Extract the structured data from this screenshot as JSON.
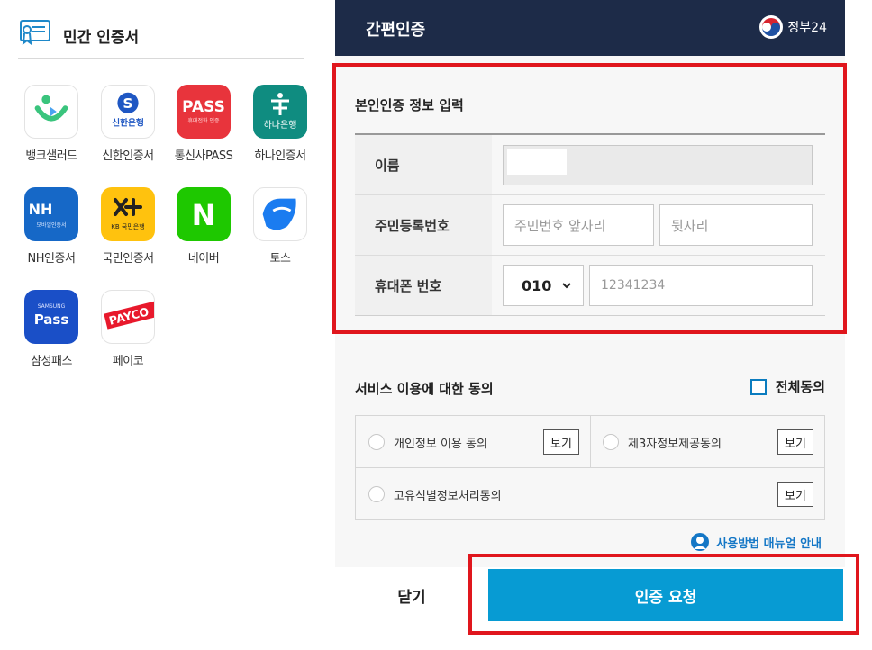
{
  "left": {
    "title": "민간 인증서",
    "apps": [
      {
        "label": "뱅크샐러드",
        "icon": "banksalad-icon"
      },
      {
        "label": "신한인증서",
        "icon": "shinhan-icon",
        "tile_text": "신한은행"
      },
      {
        "label": "통신사PASS",
        "icon": "pass-icon",
        "tile_text": "PASS",
        "tile_sub": "휴대전화 인증"
      },
      {
        "label": "하나인증서",
        "icon": "hana-icon",
        "tile_text": "하나은행"
      },
      {
        "label": "NH인증서",
        "icon": "nh-icon",
        "tile_text": "NH",
        "tile_sub": "모바일인증서"
      },
      {
        "label": "국민인증서",
        "icon": "kb-icon",
        "tile_text": "KB 국민은행"
      },
      {
        "label": "네이버",
        "icon": "naver-icon",
        "tile_text": "N"
      },
      {
        "label": "토스",
        "icon": "toss-icon"
      },
      {
        "label": "삼성패스",
        "icon": "samsung-pass-icon",
        "tile_text": "Pass",
        "tile_sub": "SAMSUNG"
      },
      {
        "label": "페이코",
        "icon": "payco-icon",
        "tile_text": "PAYCO"
      }
    ]
  },
  "header": {
    "title": "간편인증",
    "logo_text": "정부24"
  },
  "form": {
    "section_title": "본인인증 정보 입력",
    "name_label": "이름",
    "rrn_label": "주민등록번호",
    "rrn_front_placeholder": "주민번호 앞자리",
    "rrn_back_placeholder": "뒷자리",
    "phone_label": "휴대폰 번호",
    "carrier_prefix": "010",
    "phone_placeholder": "12341234"
  },
  "consent": {
    "section_title": "서비스 이용에 대한 동의",
    "all_agree": "전체동의",
    "items": [
      {
        "label": "개인정보 이용 동의",
        "view": "보기"
      },
      {
        "label": "제3자정보제공동의",
        "view": "보기"
      },
      {
        "label": "고유식별정보처리동의",
        "view": "보기"
      }
    ],
    "manual_link": "사용방법 매뉴얼 안내"
  },
  "footer": {
    "close": "닫기",
    "request": "인증 요청"
  },
  "colors": {
    "topbar": "#1d2b48",
    "accent": "#079bd3",
    "highlight": "#e0161d",
    "link": "#1477c6"
  }
}
